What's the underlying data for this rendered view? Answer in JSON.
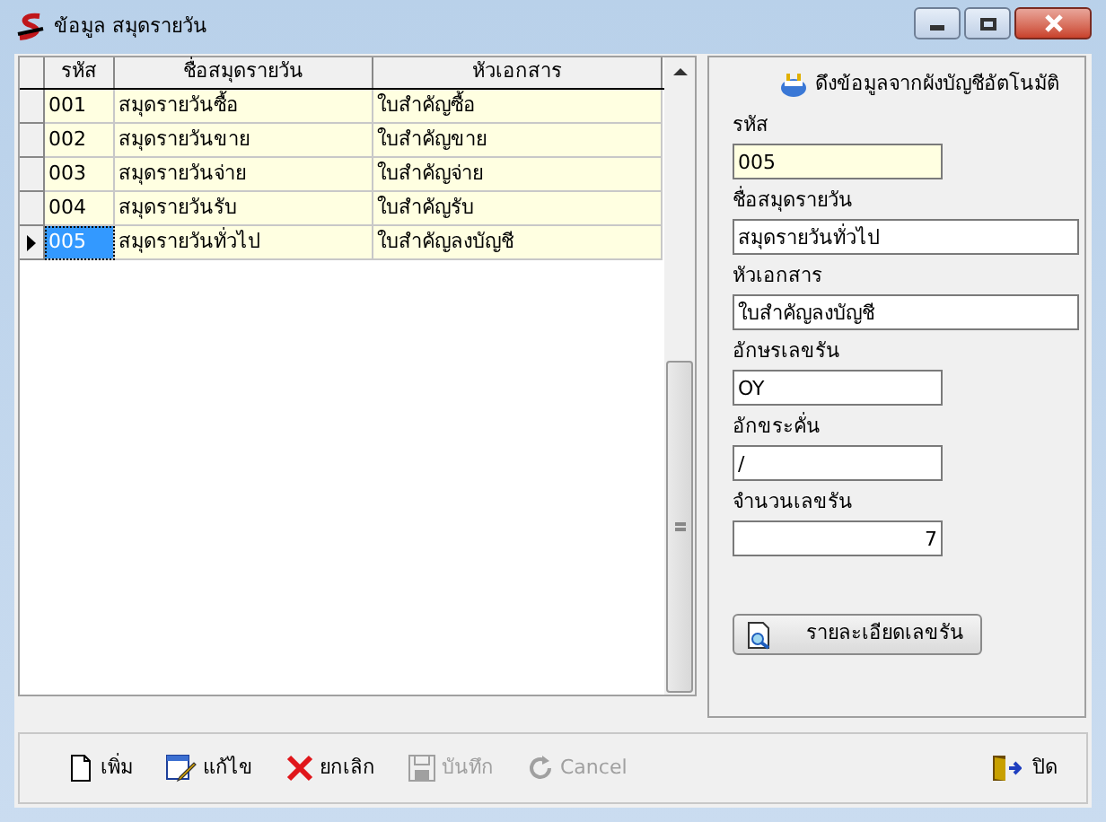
{
  "window": {
    "title": "ข้อมูล สมุดรายวัน"
  },
  "table": {
    "columns": [
      "รหัส",
      "ชื่อสมุดรายวัน",
      "หัวเอกสาร"
    ],
    "rows": [
      {
        "cells": [
          "001",
          "สมุดรายวันซื้อ",
          "ใบสำคัญซื้อ"
        ],
        "selected": false
      },
      {
        "cells": [
          "002",
          "สมุดรายวันขาย",
          "ใบสำคัญขาย"
        ],
        "selected": false
      },
      {
        "cells": [
          "003",
          "สมุดรายวันจ่าย",
          "ใบสำคัญจ่าย"
        ],
        "selected": false
      },
      {
        "cells": [
          "004",
          "สมุดรายวันรับ",
          "ใบสำคัญรับ"
        ],
        "selected": false
      },
      {
        "cells": [
          "005",
          "สมุดรายวันทั่วไป",
          "ใบสำคัญลงบัญชี"
        ],
        "selected": true
      }
    ]
  },
  "form": {
    "import_link": "ดึงข้อมูลจากผังบัญชีอัตโนมัติ",
    "fields": [
      {
        "label": "รหัส",
        "value": "005",
        "kind": "key"
      },
      {
        "label": "ชื่อสมุดรายวัน",
        "value": "สมุดรายวันทั่วไป",
        "kind": "wide"
      },
      {
        "label": "หัวเอกสาร",
        "value": "ใบสำคัญลงบัญชี",
        "kind": "wide"
      },
      {
        "label": "อักษรเลขรัน",
        "value": "OY",
        "kind": "short"
      },
      {
        "label": "อักขระคั่น",
        "value": "/",
        "kind": "short"
      },
      {
        "label": "จำนวนเลขรัน",
        "value": "7",
        "kind": "number"
      }
    ],
    "detail_button": "รายละเอียดเลขรัน"
  },
  "toolbar": [
    {
      "label": "เพิ่ม",
      "kind": "add",
      "disabled": false
    },
    {
      "label": "แก้ไข",
      "kind": "edit",
      "disabled": false
    },
    {
      "label": "ยกเลิก",
      "kind": "delete",
      "disabled": false
    },
    {
      "label": "บันทึก",
      "kind": "save",
      "disabled": true
    },
    {
      "label": "Cancel",
      "kind": "cancel",
      "disabled": true
    }
  ],
  "close_button": "ปิด"
}
